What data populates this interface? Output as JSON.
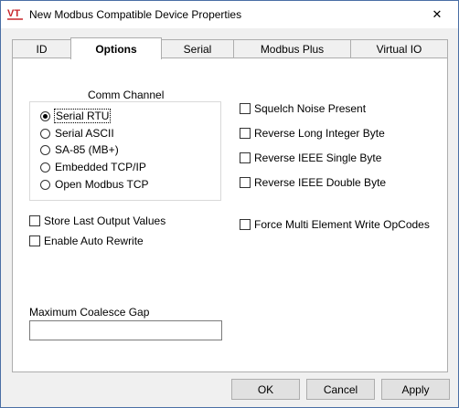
{
  "window": {
    "title": "New Modbus Compatible Device Properties",
    "icon": "vt-app-icon",
    "close_glyph": "✕"
  },
  "tabs": [
    {
      "label": "ID",
      "active": false
    },
    {
      "label": "Options",
      "active": true
    },
    {
      "label": "Serial",
      "active": false
    },
    {
      "label": "Modbus Plus",
      "active": false
    },
    {
      "label": "Virtual IO",
      "active": false
    }
  ],
  "comm_channel": {
    "title": "Comm Channel",
    "options": [
      {
        "label": "Serial RTU",
        "selected": true
      },
      {
        "label": "Serial ASCII",
        "selected": false
      },
      {
        "label": "SA-85 (MB+)",
        "selected": false
      },
      {
        "label": "Embedded TCP/IP",
        "selected": false
      },
      {
        "label": "Open Modbus TCP",
        "selected": false
      }
    ]
  },
  "left_checks": [
    {
      "label": "Store Last Output Values",
      "checked": false
    },
    {
      "label": "Enable Auto Rewrite",
      "checked": false
    }
  ],
  "right_checks": [
    {
      "label": "Squelch Noise Present",
      "checked": false
    },
    {
      "label": "Reverse Long Integer Byte",
      "checked": false
    },
    {
      "label": "Reverse IEEE Single Byte",
      "checked": false
    },
    {
      "label": "Reverse IEEE Double Byte",
      "checked": false
    },
    {
      "label": "Force Multi Element Write OpCodes",
      "checked": false
    }
  ],
  "coalesce": {
    "label": "Maximum Coalesce Gap",
    "value": ""
  },
  "buttons": {
    "ok": "OK",
    "cancel": "Cancel",
    "apply": "Apply"
  },
  "colors": {
    "window_bg": "#f0f0f0",
    "panel_bg": "#ffffff",
    "icon_red": "#c8262c"
  }
}
